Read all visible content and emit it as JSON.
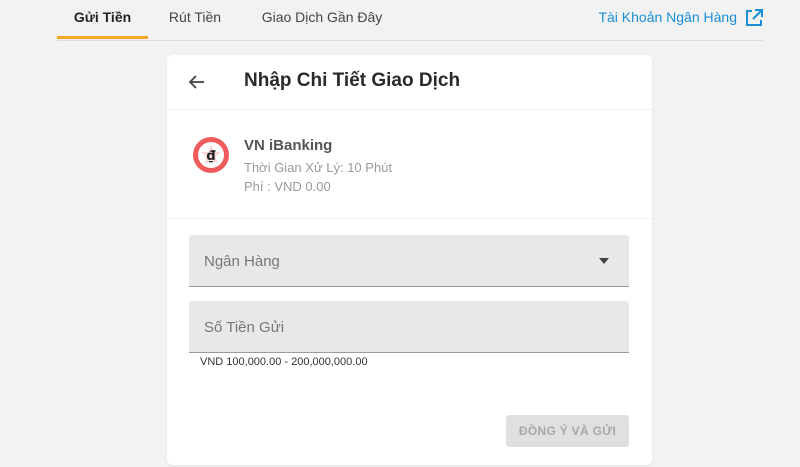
{
  "tabs": [
    {
      "label": "Gửi Tiền",
      "active": true
    },
    {
      "label": "Rút Tiền",
      "active": false
    },
    {
      "label": "Giao Dịch Gần Đây",
      "active": false
    }
  ],
  "bank_account_link": "Tài Khoản Ngân Hàng",
  "card": {
    "title": "Nhập Chi Tiết Giao Dịch"
  },
  "method": {
    "name": "VN iBanking",
    "processing_time": "Thời Gian Xử Lý: 10 Phút",
    "fee": "Phí : VND 0.00",
    "logo_glyph": "₫"
  },
  "form": {
    "bank_placeholder": "Ngân Hàng",
    "amount_placeholder": "Số Tiền Gửi",
    "amount_hint": "VND 100,000.00 - 200,000,000.00",
    "submit_label": "ĐỒNG Ý VÀ GỬI"
  },
  "colors": {
    "accent": "#f5a623",
    "link": "#1a8fd6",
    "logo_red": "#ef5a5a"
  }
}
